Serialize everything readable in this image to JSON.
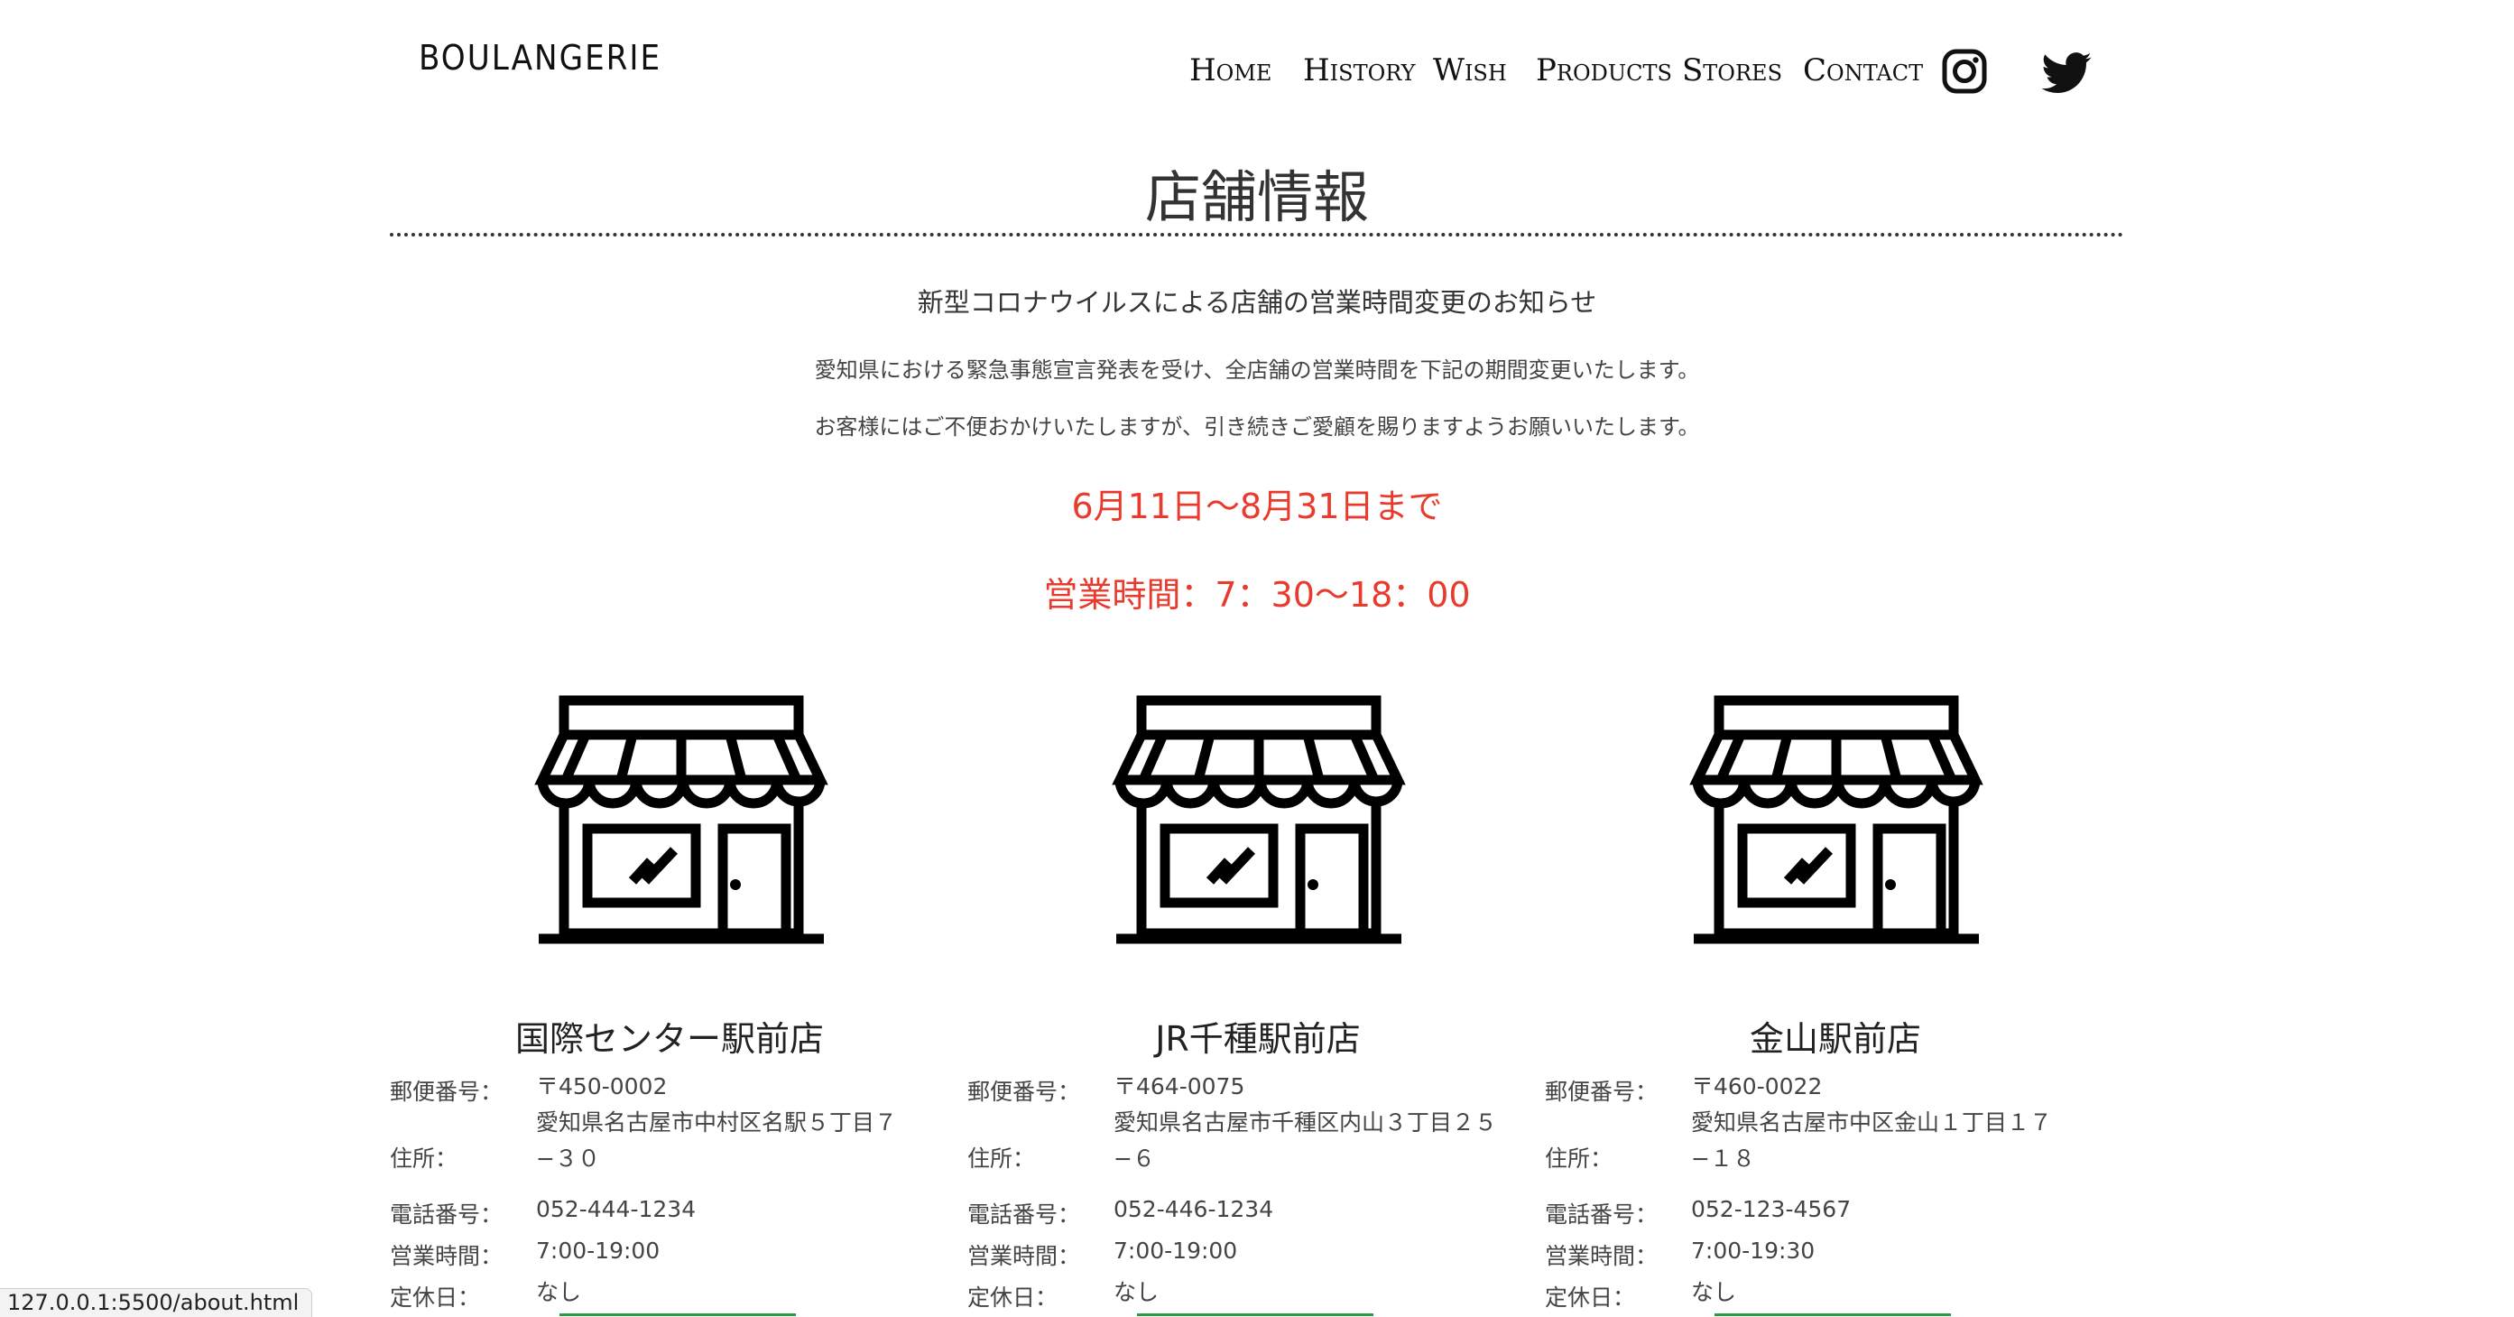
{
  "header": {
    "logo": "BOULANGERIE",
    "nav": [
      {
        "label": "Home"
      },
      {
        "label": "History"
      },
      {
        "label": "Wish"
      },
      {
        "label": "Products"
      },
      {
        "label": "Stores"
      },
      {
        "label": "Contact"
      }
    ],
    "social": [
      "instagram-icon",
      "twitter-icon"
    ]
  },
  "page": {
    "title": "店舗情報"
  },
  "notice": {
    "heading": "新型コロナウイルスによる店舗の営業時間変更のお知らせ",
    "line1": "愛知県における緊急事態宣言発表を受け、全店舗の営業時間を下記の期間変更いたします。",
    "line2": "お客様にはご不便おかけいたしますが、引き続きご愛顧を賜りますようお願いいたします。",
    "period": "6月11日〜8月31日まで",
    "hours": "営業時間：7：30〜18：00",
    "accent_color": "#e83b2e"
  },
  "stores": [
    {
      "name": "国際センター駅前店",
      "postal_label": "郵便番号：",
      "postal": "〒450-0002",
      "address_label": "住所：",
      "address": "愛知県名古屋市中村区名駅５丁目７−３０",
      "phone_label": "電話番号：",
      "phone": "052-444-1234",
      "hours_label": "営業時間：",
      "hours": "7:00-19:00",
      "closed_label": "定休日：",
      "closed": "なし"
    },
    {
      "name": "JR千種駅前店",
      "postal_label": "郵便番号：",
      "postal": "〒464-0075",
      "address_label": "住所：",
      "address": "愛知県名古屋市千種区内山３丁目２５−６",
      "phone_label": "電話番号：",
      "phone": "052-446-1234",
      "hours_label": "営業時間：",
      "hours": "7:00-19:00",
      "closed_label": "定休日：",
      "closed": "なし"
    },
    {
      "name": "金山駅前店",
      "postal_label": "郵便番号：",
      "postal": "〒460-0022",
      "address_label": "住所：",
      "address": "愛知県名古屋市中区金山１丁目１７−１８",
      "phone_label": "電話番号：",
      "phone": "052-123-4567",
      "hours_label": "営業時間：",
      "hours": "7:00-19:30",
      "closed_label": "定休日：",
      "closed": "なし"
    }
  ],
  "statusbar": {
    "url": "127.0.0.1:5500/about.html"
  },
  "colors": {
    "text": "#333333",
    "link_underline": "#2a9d3a"
  }
}
